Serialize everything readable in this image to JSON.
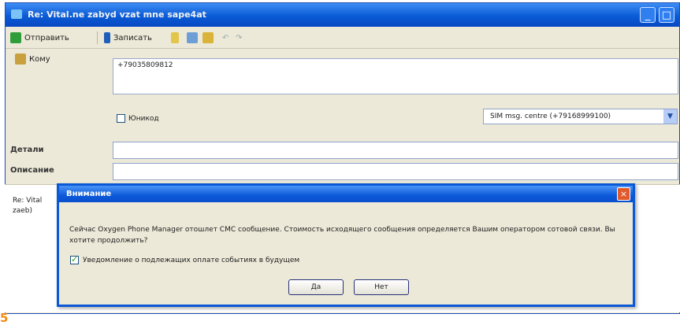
{
  "window": {
    "title": "Re: Vital.ne zabyd vzat mne sape4at"
  },
  "toolbar": {
    "send_label": "Отправить",
    "save_label": "Записать"
  },
  "form": {
    "to_label": "Кому",
    "to_value": "+79035809812",
    "unicode_label": "Юникод",
    "sim_center_value": "SIM msg. centre (+79168999100)",
    "details_label": "Детали",
    "description_label": "Описание"
  },
  "message_preview": {
    "line1": "Re: Vital",
    "line2": "zaeb)"
  },
  "dialog": {
    "title": "Внимание",
    "close_glyph": "×",
    "message": "Сейчас Oxygen Phone Manager отошлет СМС сообщение. Стоимость исходящего сообщения определяется Вашим оператором сотовой связи. Вы хотите продолжить?",
    "checkbox_label": "Уведомление о подлежащих оплате событиях в будущем",
    "yes_label": "Да",
    "no_label": "Нет"
  },
  "figure_marker": "5"
}
